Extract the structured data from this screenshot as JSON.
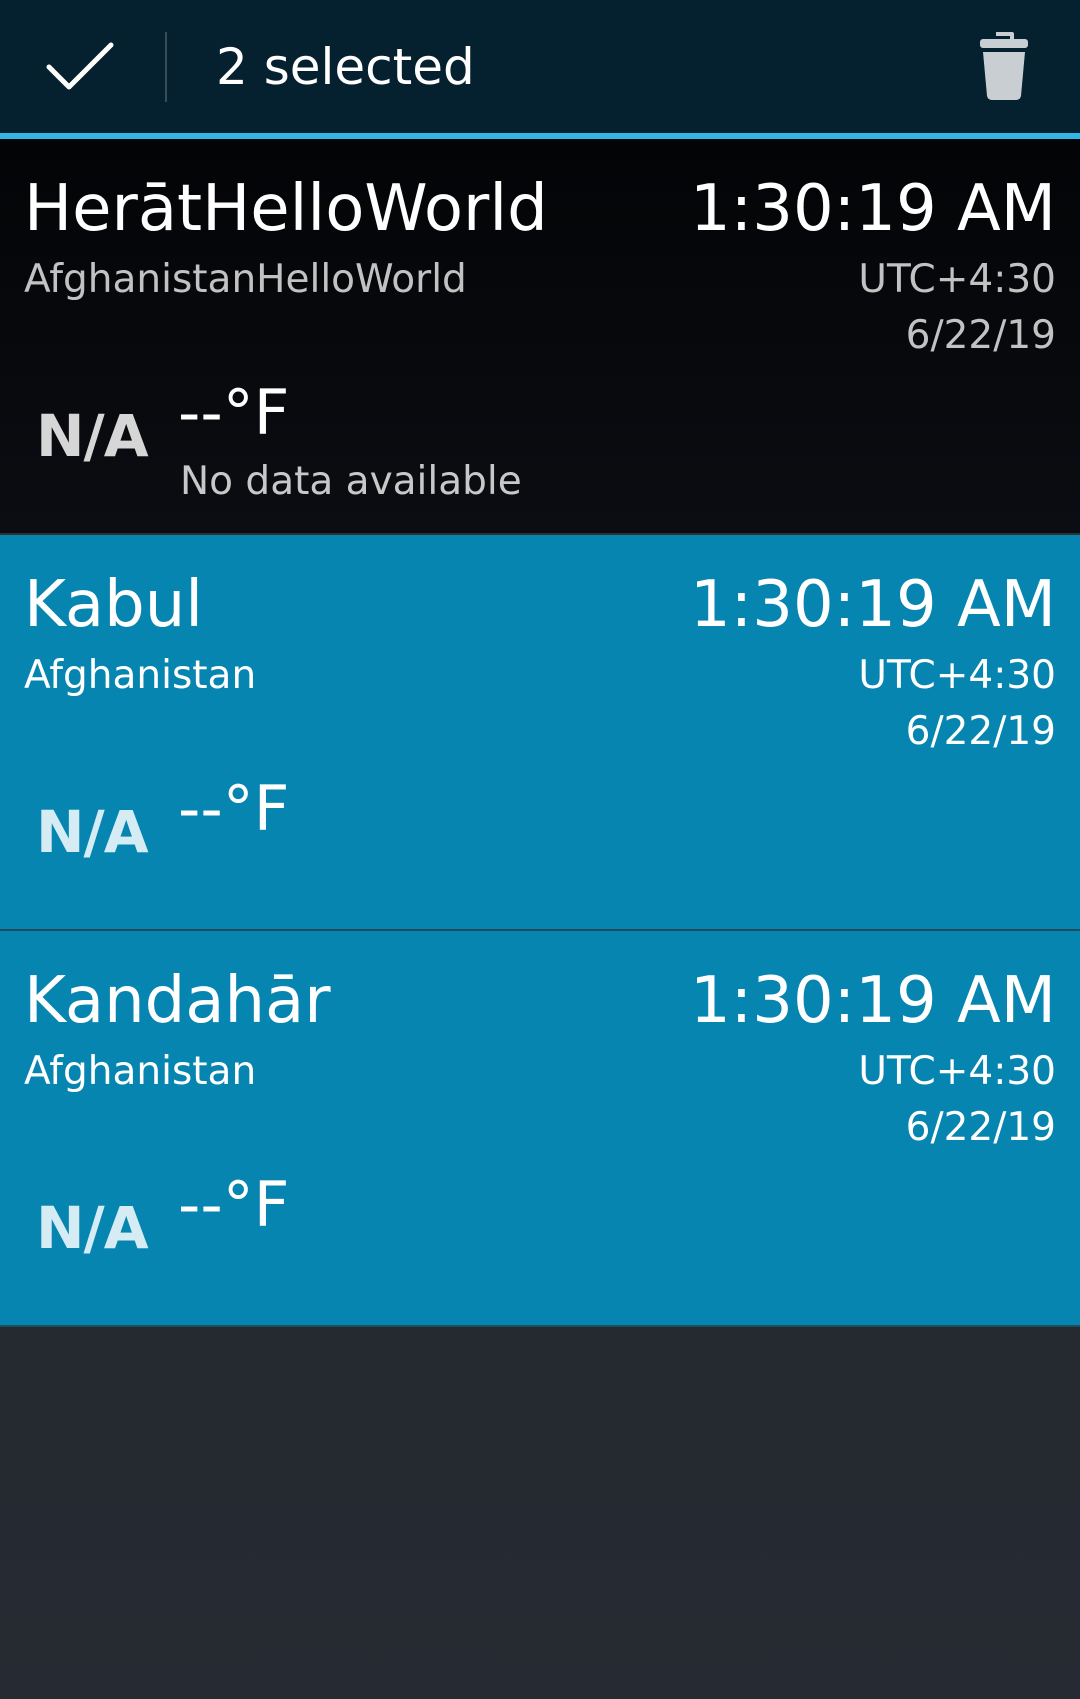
{
  "action_bar": {
    "done_icon": "check-icon",
    "title": "2 selected",
    "delete_icon": "trash-icon"
  },
  "colors": {
    "action_bar_bg": "#05202e",
    "accent": "#33b5e5",
    "selected_row_bg": "#0685b0",
    "unselected_row_bg": "#05070a"
  },
  "cities": [
    {
      "city": "HerātHelloWorld",
      "country": "AfghanistanHelloWorld",
      "time": "1:30:19 AM",
      "utc": "UTC+4:30",
      "date": "6/22/19",
      "weather_icon": "N/A",
      "temperature": "--°F",
      "condition": "No data available",
      "selected": false
    },
    {
      "city": "Kabul",
      "country": "Afghanistan",
      "time": "1:30:19 AM",
      "utc": "UTC+4:30",
      "date": "6/22/19",
      "weather_icon": "N/A",
      "temperature": "--°F",
      "condition": "",
      "selected": true
    },
    {
      "city": "Kandahār",
      "country": "Afghanistan",
      "time": "1:30:19 AM",
      "utc": "UTC+4:30",
      "date": "6/22/19",
      "weather_icon": "N/A",
      "temperature": "--°F",
      "condition": "",
      "selected": true
    }
  ]
}
